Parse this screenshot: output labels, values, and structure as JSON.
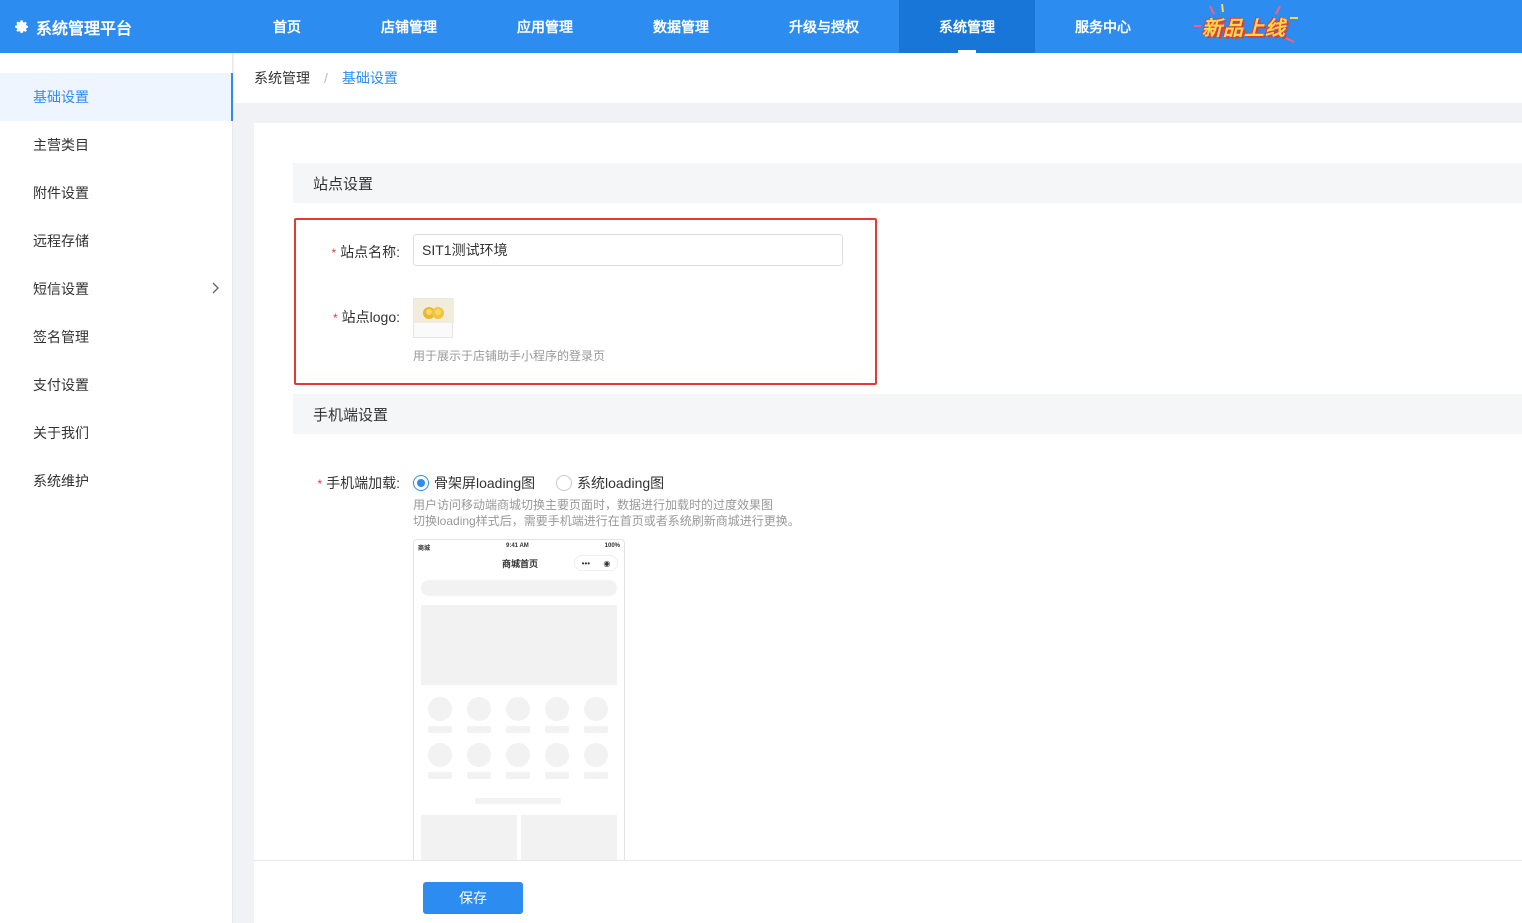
{
  "brand": {
    "title": "系统管理平台",
    "icon": "gear-icon"
  },
  "nav": {
    "items": [
      "首页",
      "店铺管理",
      "应用管理",
      "数据管理",
      "升级与授权",
      "系统管理",
      "服务中心"
    ],
    "active_index": 5,
    "promo": "新品上线"
  },
  "sidebar": {
    "items": [
      "基础设置",
      "主营类目",
      "附件设置",
      "远程存储",
      "短信设置",
      "签名管理",
      "支付设置",
      "关于我们",
      "系统维护"
    ],
    "active_index": 0
  },
  "breadcrumb": {
    "parent": "系统管理",
    "separator": "/",
    "current": "基础设置"
  },
  "site_settings": {
    "title": "站点设置",
    "name_label": "站点名称:",
    "name_value": "SIT1测试环境",
    "logo_label": "站点logo:",
    "logo_hint": "用于展示于店铺助手小程序的登录页"
  },
  "mobile_settings": {
    "title": "手机端设置",
    "loading_label": "手机端加载:",
    "option_skeleton": "骨架屏loading图",
    "option_system": "系统loading图",
    "selected": "骨架屏loading图",
    "hint_line1": "用户访问移动端商城切换主要页面时，数据进行加载时的过度效果图",
    "hint_line2": "切换loading样式后，需要手机端进行在首页或者系统刷新商城进行更换。"
  },
  "preview": {
    "carrier": "商城",
    "time": "9:41 AM",
    "battery": "100%",
    "page_title": "商城首页"
  },
  "footer": {
    "save_label": "保存"
  },
  "colors": {
    "primary": "#2d8cf0",
    "active_nav": "#1876d9",
    "highlight_border": "#e53935",
    "required": "#e53935"
  }
}
